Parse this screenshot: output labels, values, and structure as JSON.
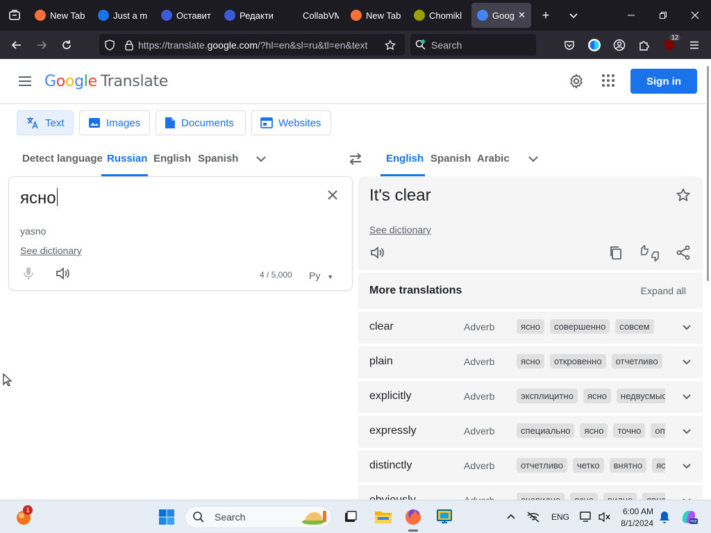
{
  "browser": {
    "tabs": [
      {
        "title": "New Tab",
        "favicon_color": "#ff7139",
        "active": false
      },
      {
        "title": "Just a m",
        "favicon_color": "#1a73e8",
        "active": false
      },
      {
        "title": "Оставит",
        "favicon_color": "#3b5bdb",
        "active": false
      },
      {
        "title": "Редакти",
        "favicon_color": "#3b5bdb",
        "active": false
      },
      {
        "title": "CollabVM Se",
        "favicon_color": "#1c1b22",
        "active": false
      },
      {
        "title": "New Tab",
        "favicon_color": "#ff7139",
        "active": false
      },
      {
        "title": "Chomikl",
        "favicon_color": "#9aa000",
        "active": false
      },
      {
        "title": "Goog",
        "favicon_color": "#4285f4",
        "active": true
      }
    ],
    "url_prefix": "https://translate.",
    "url_domain": "google.com",
    "url_suffix": "/?hl=en&sl=ru&tl=en&text",
    "search_placeholder": "Search",
    "extension_badge": "12"
  },
  "gt": {
    "logo_letters": [
      {
        "ch": "G",
        "color": "#4285f4"
      },
      {
        "ch": "o",
        "color": "#ea4335"
      },
      {
        "ch": "o",
        "color": "#fbbc05"
      },
      {
        "ch": "g",
        "color": "#4285f4"
      },
      {
        "ch": "l",
        "color": "#34a853"
      },
      {
        "ch": "e",
        "color": "#ea4335"
      }
    ],
    "logo_product": "Translate",
    "sign_in": "Sign in",
    "modes": [
      "Text",
      "Images",
      "Documents",
      "Websites"
    ],
    "source_langs": [
      "Detect language",
      "Russian",
      "English",
      "Spanish"
    ],
    "target_langs": [
      "English",
      "Spanish",
      "Arabic"
    ],
    "source_text": "ясно",
    "transliteration": "yasno",
    "see_dictionary": "See dictionary",
    "char_count": "4 / 5,000",
    "keyboard_label": "Ру",
    "translation": "It's clear",
    "more_title": "More translations",
    "expand_all": "Expand all",
    "rows": [
      {
        "word": "clear",
        "pos": "Adverb",
        "syns": [
          "ясно",
          "совершенно",
          "совсем"
        ]
      },
      {
        "word": "plain",
        "pos": "Adverb",
        "syns": [
          "ясно",
          "откровенно",
          "отчетливо"
        ]
      },
      {
        "word": "explicitly",
        "pos": "Adverb",
        "syns": [
          "эксплицитно",
          "ясно",
          "недвусмысленно"
        ]
      },
      {
        "word": "expressly",
        "pos": "Adverb",
        "syns": [
          "специально",
          "ясно",
          "точно",
          "определенно"
        ]
      },
      {
        "word": "distinctly",
        "pos": "Adverb",
        "syns": [
          "отчетливо",
          "четко",
          "внятно",
          "ясно"
        ]
      },
      {
        "word": "obviously",
        "pos": "Adverb",
        "syns": [
          "очевидно",
          "ясно",
          "видно",
          "явно"
        ]
      }
    ]
  },
  "taskbar": {
    "search_placeholder": "Search",
    "notification_count": "1",
    "language": "ENG",
    "time": "6:00 AM",
    "date": "8/1/2024"
  }
}
